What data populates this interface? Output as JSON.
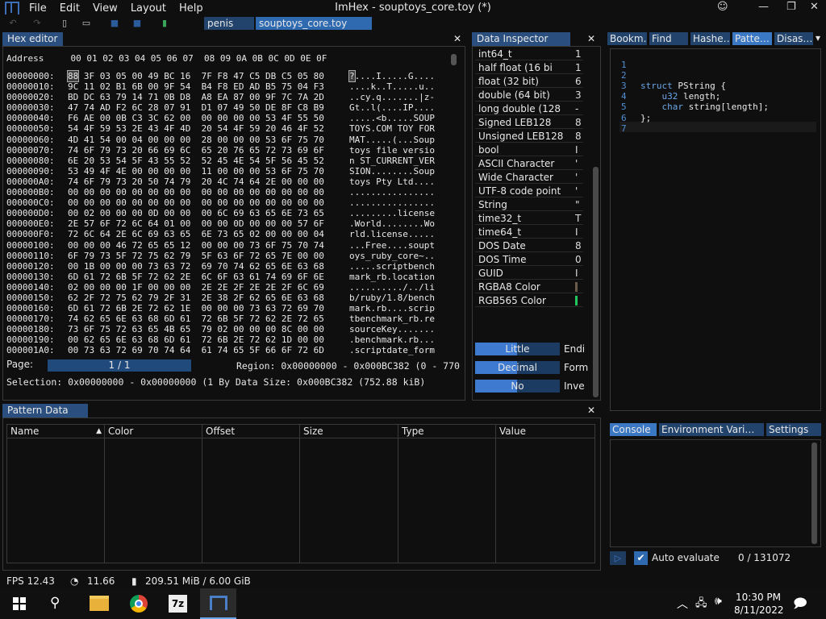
{
  "window": {
    "title": "ImHex - souptoys_core.toy (*)"
  },
  "menu": [
    "File",
    "Edit",
    "View",
    "Layout",
    "Help"
  ],
  "file_tabs": [
    "penis",
    "souptoys_core.toy"
  ],
  "hex_editor": {
    "title": "Hex editor",
    "header": "Address     00 01 02 03 04 05 06 07  08 09 0A 0B 0C 0D 0E 0F",
    "rows": [
      [
        "00000000:",
        "88 3F 03 05 00 49 BC 16  7F F8 47 C5 DB C5 05 80",
        "?....I.....G...."
      ],
      [
        "00000010:",
        "9C 11 02 B1 6B 00 9F 54  B4 F8 ED AD B5 75 04 F3",
        "....k..T.....u.."
      ],
      [
        "00000020:",
        "BD DC 63 79 14 71 0B D8  A8 EA 87 00 9F 7C 7A 2D",
        "..cy.q.......|z-"
      ],
      [
        "00000030:",
        "47 74 AD F2 6C 28 07 91  D1 07 49 50 DE 8F C8 B9",
        "Gt..l(....IP...."
      ],
      [
        "00000040:",
        "F6 AE 00 0B C3 3C 62 00  00 00 00 00 53 4F 55 50",
        ".....<b.....SOUP"
      ],
      [
        "00000050:",
        "54 4F 59 53 2E 43 4F 4D  20 54 4F 59 20 46 4F 52",
        "TOYS.COM TOY FOR"
      ],
      [
        "00000060:",
        "4D 41 54 00 04 00 00 00  28 00 00 00 53 6F 75 70",
        "MAT.....(...Soup"
      ],
      [
        "00000070:",
        "74 6F 79 73 20 66 69 6C  65 20 76 65 72 73 69 6F",
        "toys file versio"
      ],
      [
        "00000080:",
        "6E 20 53 54 5F 43 55 52  52 45 4E 54 5F 56 45 52",
        "n ST_CURRENT_VER"
      ],
      [
        "00000090:",
        "53 49 4F 4E 00 00 00 00  11 00 00 00 53 6F 75 70",
        "SION........Soup"
      ],
      [
        "000000A0:",
        "74 6F 79 73 20 50 74 79  20 4C 74 64 2E 00 00 00",
        "toys Pty Ltd...."
      ],
      [
        "000000B0:",
        "00 00 00 00 00 00 00 00  00 00 00 00 00 00 00 00",
        "................"
      ],
      [
        "000000C0:",
        "00 00 00 00 00 00 00 00  00 00 00 00 00 00 00 00",
        "................"
      ],
      [
        "000000D0:",
        "00 02 00 00 00 0D 00 00  00 6C 69 63 65 6E 73 65",
        ".........license"
      ],
      [
        "000000E0:",
        "2E 57 6F 72 6C 64 01 00  00 00 0D 00 00 00 57 6F",
        ".World........Wo"
      ],
      [
        "000000F0:",
        "72 6C 64 2E 6C 69 63 65  6E 73 65 02 00 00 00 04",
        "rld.license....."
      ],
      [
        "00000100:",
        "00 00 00 46 72 65 65 12  00 00 00 73 6F 75 70 74",
        "...Free....soupt"
      ],
      [
        "00000110:",
        "6F 79 73 5F 72 75 62 79  5F 63 6F 72 65 7E 00 00",
        "oys_ruby_core~.."
      ],
      [
        "00000120:",
        "00 1B 00 00 00 73 63 72  69 70 74 62 65 6E 63 68",
        ".....scriptbench"
      ],
      [
        "00000130:",
        "6D 61 72 6B 5F 72 62 2E  6C 6F 63 61 74 69 6F 6E",
        "mark_rb.location"
      ],
      [
        "00000140:",
        "02 00 00 00 1F 00 00 00  2E 2E 2F 2E 2E 2F 6C 69",
        "........../../li"
      ],
      [
        "00000150:",
        "62 2F 72 75 62 79 2F 31  2E 38 2F 62 65 6E 63 68",
        "b/ruby/1.8/bench"
      ],
      [
        "00000160:",
        "6D 61 72 6B 2E 72 62 1E  00 00 00 73 63 72 69 70",
        "mark.rb....scrip"
      ],
      [
        "00000170:",
        "74 62 65 6E 63 68 6D 61  72 6B 5F 72 62 2E 72 65",
        "tbenchmark_rb.re"
      ],
      [
        "00000180:",
        "73 6F 75 72 63 65 4B 65  79 02 00 00 00 8C 00 00",
        "sourceKey......."
      ],
      [
        "00000190:",
        "00 62 65 6E 63 68 6D 61  72 6B 2E 72 62 1D 00 00",
        ".benchmark.rb..."
      ],
      [
        "000001A0:",
        "00 73 63 72 69 70 74 64  61 74 65 5F 66 6F 72 6D",
        ".scriptdate_form"
      ]
    ],
    "page_label": "Page:",
    "page_value": "1 / 1",
    "region": "Region: 0x00000000 - 0x000BC382 (0 - 770",
    "selection": "Selection: 0x00000000 - 0x00000000 (1 By Data Size: 0x000BC382 (752.88 kiB)"
  },
  "data_inspector": {
    "title": "Data Inspector",
    "rows": [
      [
        "int64_t",
        "1"
      ],
      [
        "half float (16 bi",
        "1"
      ],
      [
        "float (32 bit)",
        "6"
      ],
      [
        "double (64 bit)",
        "3"
      ],
      [
        "long double (128",
        "-"
      ],
      [
        "Signed LEB128",
        "8"
      ],
      [
        "Unsigned LEB128",
        "8"
      ],
      [
        "bool",
        "I"
      ],
      [
        "ASCII Character",
        "'"
      ],
      [
        "Wide Character",
        "'"
      ],
      [
        "UTF-8 code point",
        "'"
      ],
      [
        "String",
        "\""
      ],
      [
        "time32_t",
        "T"
      ],
      [
        "time64_t",
        "I"
      ],
      [
        "DOS Date",
        "8"
      ],
      [
        "DOS Time",
        "0"
      ],
      [
        "GUID",
        "I"
      ],
      [
        "RGBA8 Color",
        ""
      ],
      [
        "RGB565 Color",
        ""
      ]
    ],
    "endian": {
      "value": "Little",
      "label": "Endi"
    },
    "format": {
      "value": "Decimal",
      "label": "Form"
    },
    "invert": {
      "value": "No",
      "label": "Inve"
    },
    "rgb565_color": "#22c55e",
    "rgba8_color": "#6b5a4a"
  },
  "right_tabs": [
    "Bookm…",
    "Find",
    "Hashe…",
    "Patte…",
    "Disas…"
  ],
  "pattern_code": {
    "lines": [
      {
        "n": "1",
        "t": ""
      },
      {
        "n": "2",
        "t": ""
      },
      {
        "n": "3",
        "kw": "struct",
        "t": " PString {"
      },
      {
        "n": "4",
        "kw": "u32",
        "t": " length;",
        "indent": "    "
      },
      {
        "n": "5",
        "kw": "char",
        "t": " string[length];",
        "indent": "    "
      },
      {
        "n": "6",
        "t": "};"
      },
      {
        "n": "7",
        "t": ""
      }
    ]
  },
  "console_tabs": [
    "Console",
    "Environment Vari…",
    "Settings"
  ],
  "console": {
    "auto_evaluate": "Auto evaluate",
    "counter": "0 / 131072"
  },
  "pattern_data": {
    "title": "Pattern Data",
    "columns": [
      "Name",
      "Color",
      "Offset",
      "Size",
      "Type",
      "Value"
    ]
  },
  "status": {
    "fps": "FPS 12.43",
    "cpu": "11.66",
    "mem": "209.51 MiB / 6.00 GiB"
  },
  "taskbar": {
    "time": "10:30 PM",
    "date": "8/11/2022",
    "zip_label": "7z"
  }
}
